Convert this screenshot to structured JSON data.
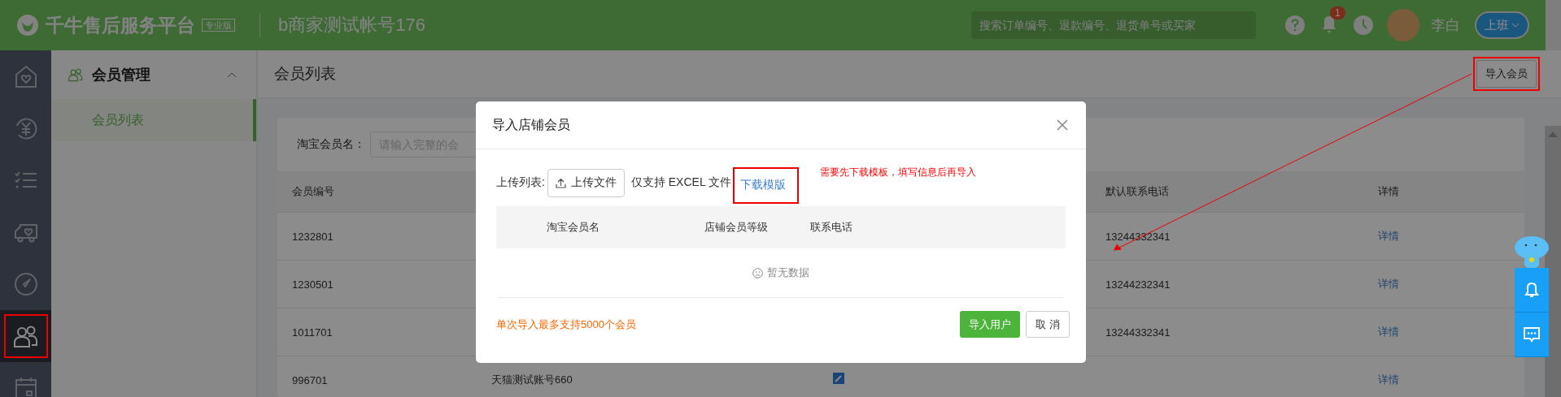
{
  "header": {
    "logo_text": "千牛售后服务平台",
    "edition_badge": "专业版",
    "account": "b商家测试帐号176",
    "search": {
      "placeholder": "搜索订单编号、退款编号、退货单号或买家"
    },
    "notification_count": "1",
    "user_name": "李白",
    "status_button": "上班"
  },
  "nav_rail": [
    {
      "kind": "home",
      "selected": false
    },
    {
      "kind": "refund",
      "selected": false
    },
    {
      "kind": "tasks",
      "selected": false
    },
    {
      "kind": "delivery",
      "selected": false
    },
    {
      "kind": "compass",
      "selected": false
    },
    {
      "kind": "members",
      "selected": true
    },
    {
      "kind": "calendar",
      "selected": false
    }
  ],
  "submenu": {
    "title": "会员管理",
    "expanded": true,
    "items": [
      {
        "label": "会员列表",
        "selected": true
      }
    ]
  },
  "page": {
    "title": "会员列表",
    "import_button": "导入会员"
  },
  "filter": {
    "label": "淘宝会员名：",
    "placeholder": "请输入完整的会"
  },
  "table": {
    "columns": [
      "会员编号",
      "默认联系电话",
      "详情"
    ],
    "rows": [
      {
        "id": "1232801",
        "phone": "13244332341",
        "detail": "详情"
      },
      {
        "id": "1230501",
        "phone": "13244232341",
        "detail": "详情"
      },
      {
        "id": "1011701",
        "phone": "13244332341",
        "detail": "详情"
      },
      {
        "id": "996701",
        "name": "天猫测试账号660",
        "detail": "详情"
      }
    ]
  },
  "modal": {
    "title": "导入店铺会员",
    "upload_label": "上传列表:",
    "upload_button": "上传文件",
    "hint": "仅支持 EXCEL 文件",
    "download_link": "下载模版",
    "columns": [
      "淘宝会员名",
      "店铺会员等级",
      "联系电话"
    ],
    "empty_text": "暂无数据",
    "note": "单次导入最多支持5000个会员",
    "confirm_button": "导入用户",
    "cancel_button": "取 消"
  },
  "annotation": {
    "note": "需要先下载模板，填写信息后再导入"
  }
}
